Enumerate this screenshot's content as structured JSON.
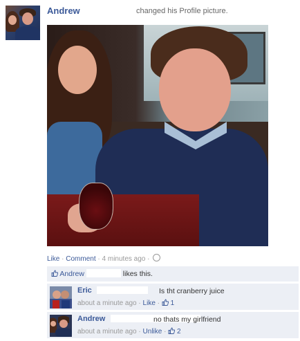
{
  "story": {
    "author": "Andrew",
    "action": "changed his Profile picture."
  },
  "meta": {
    "like": "Like",
    "sep": "·",
    "comment": "Comment",
    "time": "4 minutes ago"
  },
  "likes": {
    "name": "Andrew",
    "text": "likes this."
  },
  "comments": [
    {
      "name": "Eric",
      "text": "Is tht cranberry juice",
      "time": "about a minute ago",
      "action": "Like",
      "likes": "1"
    },
    {
      "name": "Andrew",
      "text": "no thats my girlfriend",
      "time": "about a minute ago",
      "action": "Unlike",
      "likes": "2"
    }
  ],
  "colors": {
    "link": "#3b5998",
    "ufi_bg": "#eceff5",
    "muted": "#999999"
  },
  "icons": [
    "thumbs-up-icon",
    "globe-icon",
    "profile-picture"
  ]
}
